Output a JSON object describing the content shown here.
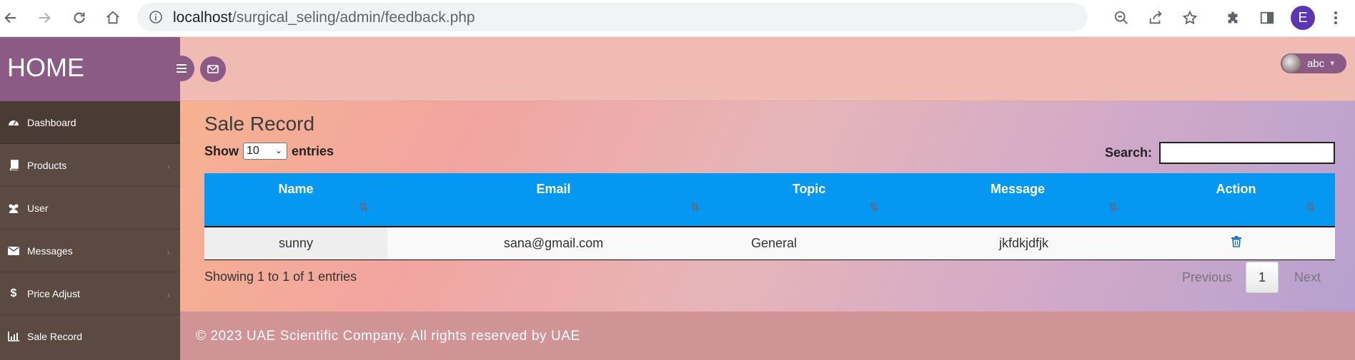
{
  "browser": {
    "url_host": "localhost",
    "url_path": "/surgical_seling/admin/feedback.php",
    "profile_initial": "E"
  },
  "sidebar": {
    "brand": "HOME",
    "items": [
      {
        "label": "Dashboard",
        "icon": "dashboard-icon",
        "has_submenu": false
      },
      {
        "label": "Products",
        "icon": "book-icon",
        "has_submenu": true
      },
      {
        "label": "User",
        "icon": "users-icon",
        "has_submenu": false
      },
      {
        "label": "Messages",
        "icon": "envelope-icon",
        "has_submenu": true
      },
      {
        "label": "Price Adjust",
        "icon": "dollar-icon",
        "has_submenu": true
      },
      {
        "label": "Sale Record",
        "icon": "bar-chart-icon",
        "has_submenu": false
      }
    ]
  },
  "topbar": {
    "user_name": "abc"
  },
  "main": {
    "title": "Sale Record",
    "show_label": "Show",
    "entries_value": "10",
    "entries_label": "entries",
    "search_label": "Search:",
    "search_value": "",
    "columns": [
      "Name",
      "Email",
      "Topic",
      "Message",
      "Action"
    ],
    "rows": [
      {
        "name": "sunny",
        "email": "sana@gmail.com",
        "topic": "General",
        "message": "jkfdkjdfjk"
      }
    ],
    "info": "Showing 1 to 1 of 1 entries",
    "pagination": {
      "previous": "Previous",
      "current": "1",
      "next": "Next"
    }
  },
  "footer": {
    "text": "© 2023 UAE Scientific Company. All rights reserved by UAE"
  },
  "colors": {
    "sidebar": "#5b4a42",
    "brand": "#8b5b85",
    "table_header": "#0598f3",
    "footer": "#d09496"
  }
}
